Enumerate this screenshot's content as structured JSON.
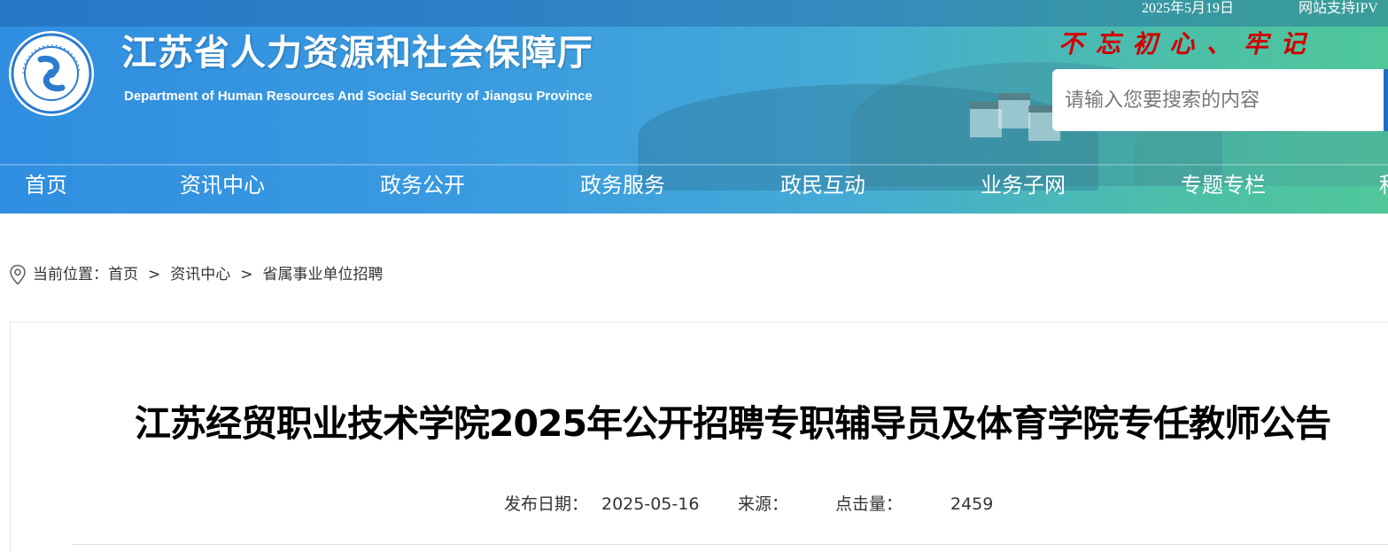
{
  "topbar": {
    "date": "2025年5月19日",
    "ipv6": "网站支持IPV"
  },
  "header": {
    "title": "江苏省人力资源和社会保障厅",
    "subtitle": "Department of Human Resources And Social Security of Jiangsu Province",
    "slogan": "不 忘 初 心  、 牢 记",
    "logo_text": "江苏省人力资源和社会保障厅"
  },
  "search": {
    "placeholder": "请输入您要搜索的内容"
  },
  "nav": {
    "items": [
      {
        "label": "首页"
      },
      {
        "label": "资讯中心"
      },
      {
        "label": "政务公开"
      },
      {
        "label": "政务服务"
      },
      {
        "label": "政民互动"
      },
      {
        "label": "业务子网"
      },
      {
        "label": "专题专栏"
      },
      {
        "label": "积"
      }
    ]
  },
  "breadcrumb": {
    "prefix": "当前位置：",
    "items": [
      "首页",
      "资讯中心",
      "省属事业单位招聘"
    ],
    "separator": ">"
  },
  "article": {
    "title": "江苏经贸职业技术学院2025年公开招聘专职辅导员及体育学院专任教师公告",
    "date_label": "发布日期：",
    "date": "2025-05-16",
    "source_label": "来源：",
    "source": "",
    "views_label": "点击量：",
    "views": "2459"
  },
  "colors": {
    "header_gradient_start": "#2f8ee0",
    "header_gradient_end": "#4fc79a",
    "slogan": "#d00000",
    "title": "#000000"
  }
}
